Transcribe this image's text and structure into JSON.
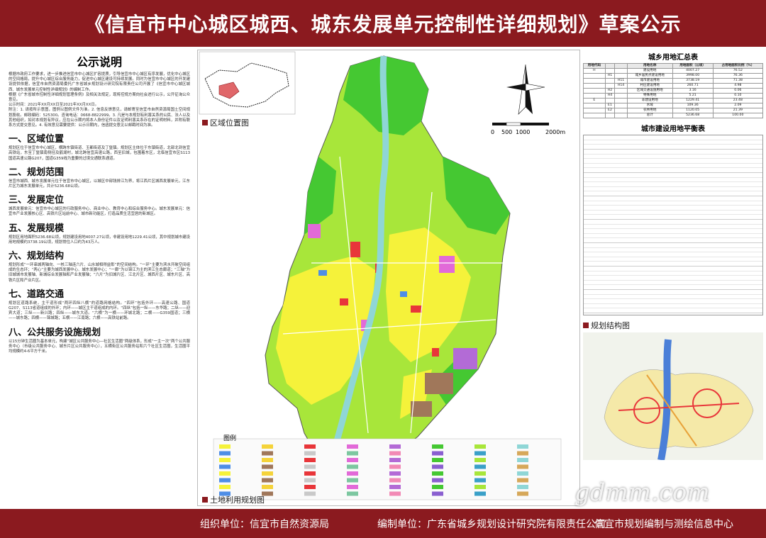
{
  "title": "《信宜市中心城区城西、城东发展单元控制性详细规划》草案公示",
  "footer": {
    "organizer": "组织单位：信宜市自然资源局",
    "compiler": "编制单位：广东省城乡规划设计研究院有限责任公司",
    "center": "信宜市规划编制与测绘信息中心"
  },
  "watermark": "gdmm.com",
  "left_panel": {
    "heading": "公示说明",
    "intro": "根据市政府工作要求，进一步推进信宜市中心城区扩容提质，引导信宜市中心城区有序发展，优化中心城区的空间格局，提升中心城区综合服务能力，促进中心城区建设可持续发展。同时为信宜市中心城区的开发建设提供依据，信宜市自然资源局委托广东省城乡规划设计研究院有限责任公司开展了《信宜市中心城区城西、城东发展单元控制性详细规划》的编制工作。",
    "law": "根据《广东省城市控制性详细规划管理条例》及相关法规定，现将控规方案向社会进行公示，公开征询公众意见。",
    "period": "公示时间：2021年XX月XX日至2021年XX月XX日。",
    "notes": "附注：1. 请按所示意图，图例以图例文件为准。2. 信息反馈意见，请邮寄至信宜市自然资源局国土空间规划股收。邮政编码：525300。咨询电话：0668-8822999。3. 凡是与本规划有利害关系的公民、法人以及其他组织，如对本规划有异议，应在公示期内将本人身份证件以及证明利害关系存在的证明材料，并附有联系方式提交意见。4. 有效意见需要提供：公示日期内，信函提交意见以邮戳时间为准。",
    "sections": [
      {
        "title": "一、区域位置",
        "text": "规划区位于信宜市中心城区，横跨东镇街道、玉都街道及丁堡镇。规划区主体位于东镇街道，北部北到信宜高铁站，东至丁堡镇南侧径及鹤湖村，城北跨信宜高速公路，西至旧城，包围着东区，北临信宜市区S113国道高速公路G207，国道G359线为重要的过境交通联系通道。"
      },
      {
        "title": "二、规划范围",
        "text": "信宜市城西、城东发展单元位于信宜市中心城区，以城区中部钱排江为界，将江西片区城西发展单元，江东片区为城东发展单元，共计5236.68公顷。"
      },
      {
        "title": "三、发展定位",
        "text": "城西发展单元：信宜市中心城区的行政服务中心、商业中心、教育中心和综合服务中心。城东发展单元：信宜市产业发展核心区、高铁片区站前中心、城市新功能区，打造品质生活宜居的新城区。"
      },
      {
        "title": "五、发展规模",
        "text": "规划区用地面积5236.68公顷，规划建设用地4007.27公顷，非建设用地1229.41公顷，其中规划城市建设用地规模约3738.19公顷，规划常住人口约为43万人。"
      },
      {
        "title": "六、规划结构",
        "text": "规划形成“一环串城两轴向、一核三轴连六片、山水城相得益彰”的空间结构。“一环”主要为滨水开敞空间组成的生态环；“两心”主要为城西发展中心、城东发展中心；“一廊”为以锦江为主的滨江生态廊道；“三轴”为旧城城市发展轴、新城综合发展轴和产业发展轴；“六片”为旧城片区、江北片区、城西片区、城东片区、高铁片区和产业片区。"
      },
      {
        "title": "七、道路交通",
        "text": "规划区道路系统，主干道形成“两环四纵八横”的道路网格结构。“四环”包括外环——高速公路、国道G207、S113省道组成的外环；内环——城区主干道组成的内环。“四纵”包括一纵——东华路；二纵——迎宾大道；三纵——新兴路；四纵——城东大道。“六横”为一横——环城北路；二横——G359国道；三横——城东路；四横——锦城路；五横——江南路；六横——高铁站前路。"
      },
      {
        "title": "八、公共服务设施规划",
        "text": "以15分钟生活圈为基本单元，构建“城区公共服务中心—社区生活圈”两级体系，形成“一主一次”两个公共服务中心（市级公共服务中心、城东片区公共服务中心），五横街区公共服务站和六个社区生活圈，生活圈平均规模约4-6平方千米。"
      }
    ]
  },
  "map_labels": {
    "location": "区域位置图",
    "landuse": "土地利用规划图",
    "legend": "图例",
    "scale_ticks": [
      "0",
      "500",
      "1000",
      "2000m"
    ]
  },
  "right_panel": {
    "table1_title": "城乡用地汇总表",
    "table1_headers": [
      "用地代码",
      "",
      "",
      "用地名称",
      "用地面积（公顷）",
      "占用地面积比例（%）"
    ],
    "table1_rows": [
      [
        "H",
        "",
        "",
        "建设用地",
        "4007.27",
        "76.52"
      ],
      [
        "",
        "H1",
        "",
        "城乡居民点建设用地",
        "3998.00",
        "76.36"
      ],
      [
        "",
        "",
        "H11",
        "城市建设用地",
        "3738.19",
        "71.38"
      ],
      [
        "",
        "",
        "H14",
        "村庄建设用地",
        "260.71",
        "4.98"
      ],
      [
        "",
        "H2",
        "",
        "区域交通设施用地",
        "3.16",
        "0.06"
      ],
      [
        "",
        "H4",
        "",
        "特殊用地",
        "5.21",
        "0.10"
      ],
      [
        "E",
        "",
        "",
        "非建设用地",
        "1229.41",
        "23.48"
      ],
      [
        "",
        "E1",
        "",
        "水域",
        "109.36",
        "2.09"
      ],
      [
        "",
        "E2",
        "",
        "农林用地",
        "1120.05",
        "21.39"
      ],
      [
        "",
        "",
        "",
        "总计",
        "5236.68",
        "100.00"
      ]
    ],
    "table2_title": "城市建设用地平衡表",
    "structure_label": "规划结构图"
  },
  "colors": {
    "brand": "#8b1a1f",
    "residential": "#f5f23a",
    "green": "#45c832",
    "forest": "#a8e63a",
    "commercial": "#e8363a",
    "public": "#e26ad8",
    "water": "#8fd6d6",
    "industrial": "#a0775a"
  }
}
